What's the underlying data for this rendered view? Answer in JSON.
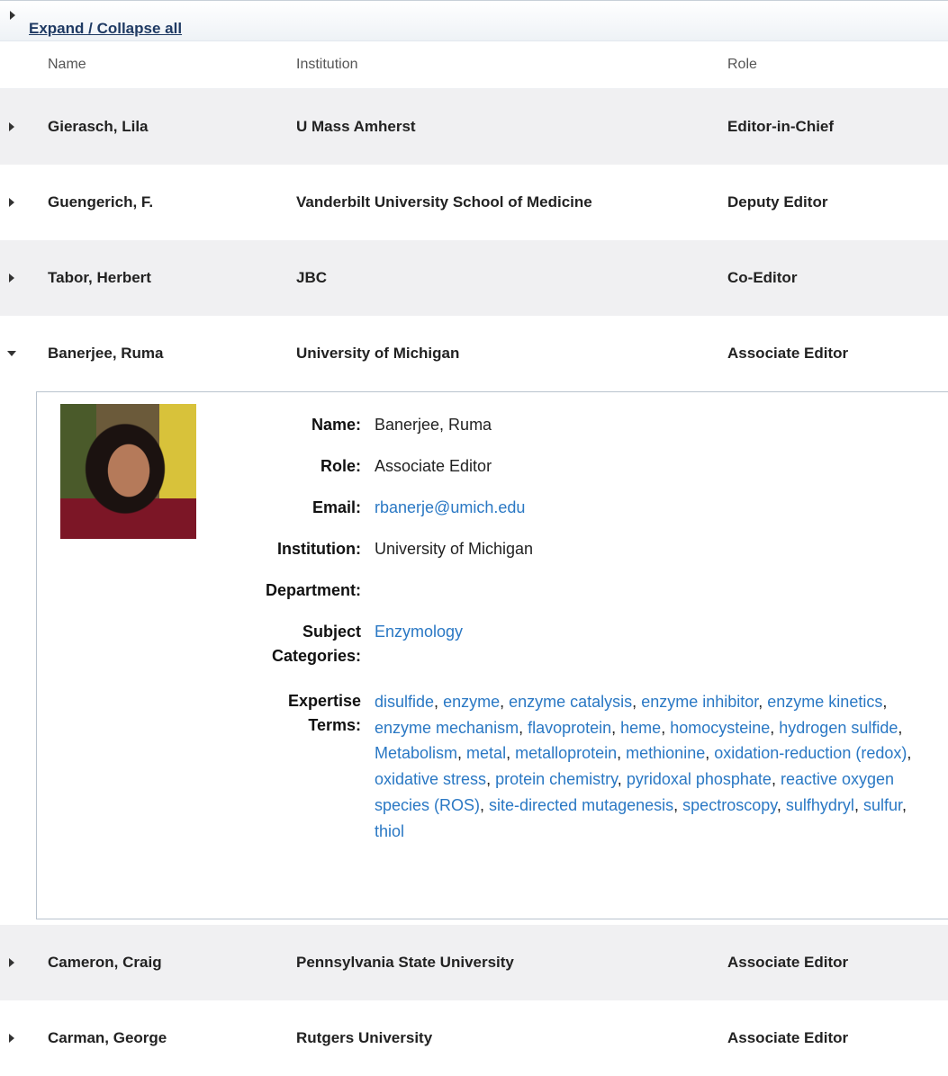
{
  "toolbar": {
    "expand_label": "Expand / Collapse all"
  },
  "columns": {
    "name": "Name",
    "institution": "Institution",
    "role": "Role"
  },
  "rows_before": [
    {
      "name": "Gierasch, Lila",
      "institution": "U Mass Amherst",
      "role": "Editor-in-Chief"
    },
    {
      "name": "Guengerich, F.",
      "institution": "Vanderbilt University School of Medicine",
      "role": "Deputy Editor"
    },
    {
      "name": "Tabor, Herbert",
      "institution": "JBC",
      "role": "Co-Editor"
    }
  ],
  "expanded_row": {
    "name": "Banerjee, Ruma",
    "institution": "University of Michigan",
    "role": "Associate Editor"
  },
  "detail": {
    "labels": {
      "name": "Name:",
      "role": "Role:",
      "email": "Email:",
      "institution": "Institution:",
      "department": "Department:",
      "subject_1": "Subject",
      "subject_2": "Categories:",
      "expertise_1": "Expertise",
      "expertise_2": "Terms:"
    },
    "name": "Banerjee, Ruma",
    "role": "Associate Editor",
    "email": "rbanerje@umich.edu",
    "institution": "University of Michigan",
    "department": "",
    "subject_categories": [
      "Enzymology"
    ],
    "expertise_terms": [
      "disulfide",
      "enzyme",
      "enzyme catalysis",
      "enzyme inhibitor",
      "enzyme kinetics",
      "enzyme mechanism",
      "flavoprotein",
      "heme",
      "homocysteine",
      "hydrogen sulfide",
      "Metabolism",
      "metal",
      "metalloprotein",
      "methionine",
      "oxidation-reduction (redox)",
      "oxidative stress",
      "protein chemistry",
      "pyridoxal phosphate",
      "reactive oxygen species (ROS)",
      "site-directed mutagenesis",
      "spectroscopy",
      "sulfhydryl",
      "sulfur",
      "thiol"
    ]
  },
  "rows_after": [
    {
      "name": "Cameron, Craig",
      "institution": "Pennsylvania State University",
      "role": "Associate Editor"
    },
    {
      "name": "Carman, George",
      "institution": "Rutgers University",
      "role": "Associate Editor"
    }
  ],
  "colors": {
    "link": "#2a78c4",
    "row_alt": "#f0f0f2",
    "header_link": "#1f3a63"
  }
}
